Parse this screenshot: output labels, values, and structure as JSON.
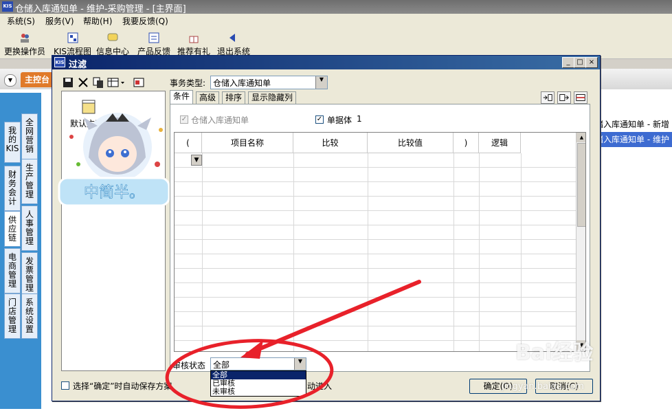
{
  "app": {
    "logo": "KIS",
    "title": "仓储入库通知单 - 维护-采购管理 - [主界面]"
  },
  "menu": [
    "系统(S)",
    "服务(V)",
    "帮助(H)",
    "我要反馈(Q)"
  ],
  "toolbar": [
    "更换操作员",
    "KIS流程图",
    "信息中心",
    "产品反馈",
    "推荐有礼",
    "退出系统"
  ],
  "home_tab": "主控台",
  "side_tabs": [
    "我的KIS",
    "全网营销",
    "财务会计",
    "生产管理",
    "供应链",
    "人事管理",
    "电商管理",
    "发票管理",
    "门店管理",
    "系统设置"
  ],
  "right_list": [
    "储入库通知单 - 新增",
    "储入库通知单 - 维护"
  ],
  "dialog": {
    "logo": "KIS",
    "title": "过滤",
    "window_buttons": {
      "minimize": "_",
      "maximize": "□",
      "close": "×"
    },
    "type_label": "事务类型:",
    "type_value": "仓储入库通知单",
    "scheme_label": "默认方案",
    "tabs": [
      "条件",
      "高级",
      "排序",
      "显示隐藏列"
    ],
    "voucher_check": "仓储入库通知单",
    "single_check": "单据体",
    "single_count": "1",
    "grid_headers": [
      "(",
      "项目名称",
      "比较",
      "比较值",
      ")",
      "逻辑"
    ],
    "audit_label": "审核状态",
    "audit_value": "全部",
    "audit_options": [
      "全部",
      "已审核",
      "未审核"
    ],
    "autosave": "选择“确定”时自动保存方案",
    "fragment": "动进入",
    "ok": "确定(O)",
    "cancel": "取消(C)"
  },
  "art_text": "中简半。",
  "watermark": {
    "brand": "Bai经验",
    "sub": "jingyan.baidu.com"
  },
  "colors": {
    "titlebar": "#0a246a",
    "highlight": "#0a246a",
    "annotation": "#e8212a",
    "accent": "#e07a2a"
  }
}
